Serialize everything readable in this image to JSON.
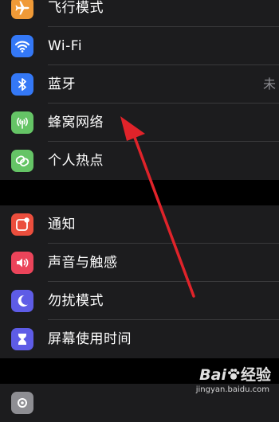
{
  "colors": {
    "background": "#000000",
    "group_bg": "#1c1c1e",
    "separator": "#3a3a3c",
    "secondary_text": "#8d8d92",
    "annotation_arrow": "#e0232a"
  },
  "groups": [
    {
      "items": [
        {
          "label": "飞行模式",
          "icon": "airplane-icon",
          "color": "#f09a37"
        },
        {
          "label": "Wi-Fi",
          "icon": "wifi-icon",
          "color": "#3478f6"
        },
        {
          "label": "蓝牙",
          "icon": "bluetooth-icon",
          "color": "#3478f6",
          "value": "未"
        },
        {
          "label": "蜂窝网络",
          "icon": "antenna-icon",
          "color": "#65c466"
        },
        {
          "label": "个人热点",
          "icon": "hotspot-icon",
          "color": "#65c466"
        }
      ]
    },
    {
      "items": [
        {
          "label": "通知",
          "icon": "notification-icon",
          "color": "#eb4e3d"
        },
        {
          "label": "声音与触感",
          "icon": "speaker-icon",
          "color": "#eb445a"
        },
        {
          "label": "勿扰模式",
          "icon": "moon-icon",
          "color": "#5e5ce6"
        },
        {
          "label": "屏幕使用时间",
          "icon": "hourglass-icon",
          "color": "#5e5ce6"
        }
      ]
    },
    {
      "items": [
        {
          "label": "",
          "icon": "gear-icon",
          "color": "#8e8e93"
        }
      ]
    }
  ],
  "watermark": {
    "logo_left": "Bai",
    "logo_exp": "经验",
    "url": "jingyan.baidu.com"
  }
}
